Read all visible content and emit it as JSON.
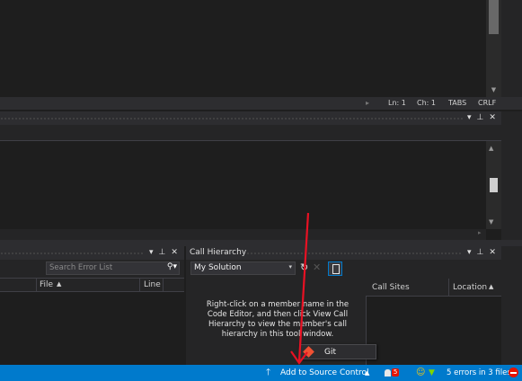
{
  "editor": {
    "line": "Ln: 1",
    "col": "Ch: 1",
    "indent": "TABS",
    "eol": "CRLF"
  },
  "error_list": {
    "search_placeholder": "Search Error List",
    "columns": [
      "File",
      "Line"
    ]
  },
  "call_hierarchy": {
    "title": "Call Hierarchy",
    "scope": "My Solution",
    "columns": [
      "Call Sites",
      "Location"
    ],
    "message": "Right-click on a member name in the Code Editor, and then click View Call Hierarchy to view the member's call hierarchy in this tool window."
  },
  "popup": {
    "item": "Git"
  },
  "status_bar": {
    "source_control": "Add to Source Control",
    "notifications_count": "5",
    "errors": "5 errors in 3 files"
  },
  "colors": {
    "status_bar": "#007acc",
    "annotation_arrow": "#e81123"
  }
}
